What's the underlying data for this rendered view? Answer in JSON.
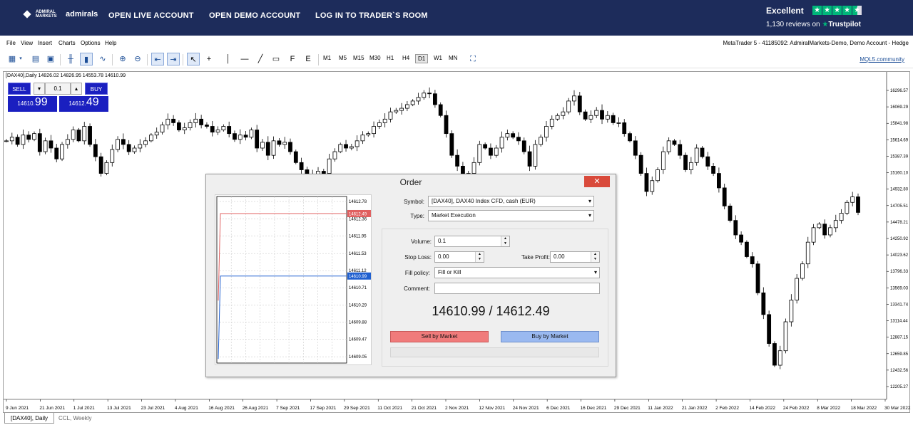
{
  "banner": {
    "logo_small": "ADMIRAL MARKETS",
    "logo_big": "admirals",
    "nav": [
      "OPEN LIVE ACCOUNT",
      "OPEN DEMO ACCOUNT",
      "LOG IN TO TRADER`S ROOM"
    ],
    "trustpilot_rating": "Excellent",
    "trustpilot_reviews": "1,130 reviews on",
    "trustpilot_brand": "Trustpilot",
    "star_color": "#00b67a",
    "stars": 4.5
  },
  "menu": [
    "File",
    "View",
    "Insert",
    "Charts",
    "Options",
    "Help"
  ],
  "account_title": "MetaTrader 5 - 41185092: AdmiralMarkets-Demo, Demo Account - Hedge",
  "toolbar": {
    "timeframes": [
      "M1",
      "M5",
      "M15",
      "M30",
      "H1",
      "H4",
      "D1",
      "W1",
      "MN"
    ],
    "active_timeframe": "D1",
    "mql_link": "MQL5.community"
  },
  "chart": {
    "header": "[DAX40],Daily  14826.02 14826.95 14553.78 14610.99",
    "one_click": {
      "sell_label": "SELL",
      "buy_label": "BUY",
      "volume": "0.1",
      "sell_price_small": "14610.",
      "sell_price_big": "99",
      "buy_price_small": "14612.",
      "buy_price_big": "49"
    }
  },
  "chart_data": {
    "type": "candlestick",
    "title": "[DAX40],Daily",
    "price_ticks": [
      "16296.57",
      "16069.29",
      "15841.98",
      "15614.69",
      "15387.39",
      "15160.10",
      "14932.80",
      "14705.51",
      "14478.21",
      "14250.92",
      "14023.62",
      "13796.33",
      "13569.03",
      "13341.74",
      "13114.44",
      "12887.15",
      "12659.85",
      "12432.56",
      "12205.27"
    ],
    "date_ticks": [
      "9 Jun 2021",
      "21 Jun 2021",
      "1 Jul 2021",
      "13 Jul 2021",
      "23 Jul 2021",
      "4 Aug 2021",
      "16 Aug 2021",
      "26 Aug 2021",
      "7 Sep 2021",
      "17 Sep 2021",
      "29 Sep 2021",
      "11 Oct 2021",
      "21 Oct 2021",
      "2 Nov 2021",
      "12 Nov 2021",
      "24 Nov 2021",
      "6 Dec 2021",
      "16 Dec 2021",
      "29 Dec 2021",
      "11 Jan 2022",
      "21 Jan 2022",
      "2 Feb 2022",
      "14 Feb 2022",
      "24 Feb 2022",
      "8 Mar 2022",
      "18 Mar 2022",
      "30 Mar 2022"
    ],
    "ylim": [
      12205.27,
      16296.57
    ],
    "last_bar": {
      "open": 14826.02,
      "high": 14826.95,
      "low": 14553.78,
      "close": 14610.99
    },
    "close_path": [
      15600,
      15650,
      15550,
      15680,
      15620,
      15700,
      15450,
      15600,
      15500,
      15350,
      15550,
      15620,
      15750,
      15600,
      15800,
      15550,
      15380,
      15150,
      15300,
      15480,
      15620,
      15550,
      15450,
      15500,
      15550,
      15600,
      15680,
      15720,
      15820,
      15900,
      15850,
      15750,
      15780,
      15850,
      15900,
      15820,
      15800,
      15720,
      15750,
      15800,
      15700,
      15620,
      15680,
      15650,
      15750,
      15500,
      15580,
      15400,
      15600,
      15550,
      15580,
      15450,
      15300,
      15200,
      15120,
      15050,
      15180,
      15150,
      15350,
      15450,
      15550,
      15500,
      15520,
      15600,
      15680,
      15700,
      15800,
      15850,
      15900,
      16000,
      16020,
      16050,
      16100,
      16150,
      16200,
      16260,
      16250,
      16100,
      15950,
      15700,
      15400,
      15250,
      15100,
      15150,
      15300,
      15550,
      15500,
      15400,
      15500,
      15650,
      15700,
      15650,
      15600,
      15450,
      15250,
      15550,
      15650,
      15800,
      15900,
      15950,
      16000,
      16150,
      16220,
      16000,
      15900,
      15950,
      16020,
      15900,
      15950,
      15850,
      15850,
      15700,
      15600,
      15400,
      15150,
      14900,
      15050,
      15200,
      15450,
      15600,
      15550,
      15400,
      15200,
      15300,
      15500,
      15380,
      15250,
      15150,
      14950,
      14700,
      14500,
      14300,
      14200,
      14000,
      13900,
      13500,
      13200,
      12800,
      12500,
      12700,
      13100,
      13400,
      13700,
      13900,
      14200,
      14400,
      14450,
      14300,
      14400,
      14500,
      14600,
      14750,
      14826,
      14611
    ]
  },
  "tabs": [
    "[DAX40], Daily",
    "CCL, Weekly"
  ],
  "order_dialog": {
    "title": "Order",
    "close": "✕",
    "symbol_label": "Symbol:",
    "symbol_value": "[DAX40], DAX40 Index CFD, cash (EUR)",
    "type_label": "Type:",
    "type_value": "Market Execution",
    "volume_label": "Volume:",
    "volume_value": "0.1",
    "sl_label": "Stop Loss:",
    "sl_value": "0.00",
    "tp_label": "Take Profit:",
    "tp_value": "0.00",
    "fill_label": "Fill policy:",
    "fill_value": "Fill or Kill",
    "comment_label": "Comment:",
    "comment_value": "",
    "prices": "14610.99 / 14612.49",
    "sell_button": "Sell by Market",
    "buy_button": "Buy by Market",
    "mini_chart": {
      "ticks": [
        "14612.78",
        "14612.36",
        "14611.95",
        "14611.53",
        "14611.12",
        "14610.71",
        "14610.29",
        "14609.88",
        "14609.47",
        "14609.05"
      ],
      "ask_label": "14612.49",
      "bid_label": "14610.99",
      "ask": 14612.49,
      "bid": 14610.99,
      "range": [
        14608.9,
        14612.9
      ],
      "ask_color": "#e06060",
      "bid_color": "#2060d0"
    }
  }
}
